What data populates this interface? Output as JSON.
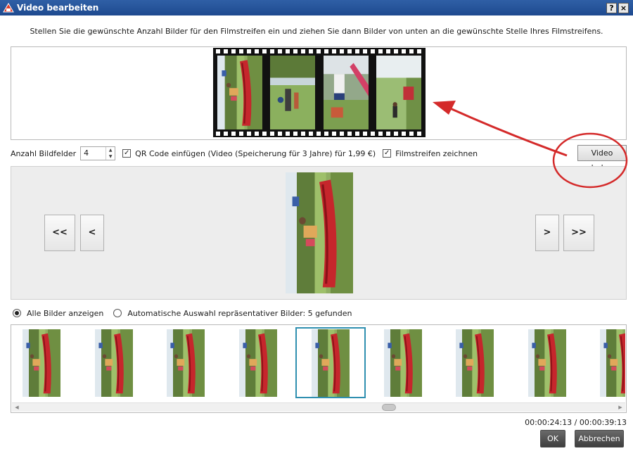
{
  "window": {
    "title": "Video bearbeiten",
    "help_label": "?",
    "close_label": "×"
  },
  "instruction": "Stellen Sie die gewünschte Anzahl Bilder für den Filmstreifen ein und ziehen Sie dann Bilder von unten an die gewünschte Stelle Ihres Filmstreifens.",
  "controls": {
    "frames_label": "Anzahl Bildfelder",
    "frames_value": "4",
    "qr_checked": true,
    "qr_label": "QR Code einfügen (Video (Speicherung für 3 Jahre) für 1,99 €)",
    "film_checked": true,
    "film_label": "Filmstreifen zeichnen",
    "rotate_label": "Video drehen"
  },
  "navigation": {
    "first_label": "<<",
    "prev_label": "<",
    "next_label": ">",
    "last_label": ">>"
  },
  "selection": {
    "all_label": "Alle Bilder anzeigen",
    "all_selected": true,
    "auto_label": "Automatische Auswahl repräsentativer Bilder: 5 gefunden",
    "auto_selected": false
  },
  "thumbnails": {
    "count": 9,
    "selected_index": 4
  },
  "timecode": "00:00:24:13 / 00:00:39:13",
  "buttons": {
    "ok_label": "OK",
    "cancel_label": "Abbrechen"
  },
  "colors": {
    "titlebar": "#1e4a8f",
    "annotation": "#d42a2a",
    "selection_border": "#2f8fb0"
  },
  "icons": {
    "app": "video-app-icon",
    "scroll_left": "arrow-left-icon",
    "scroll_right": "arrow-right-icon"
  }
}
